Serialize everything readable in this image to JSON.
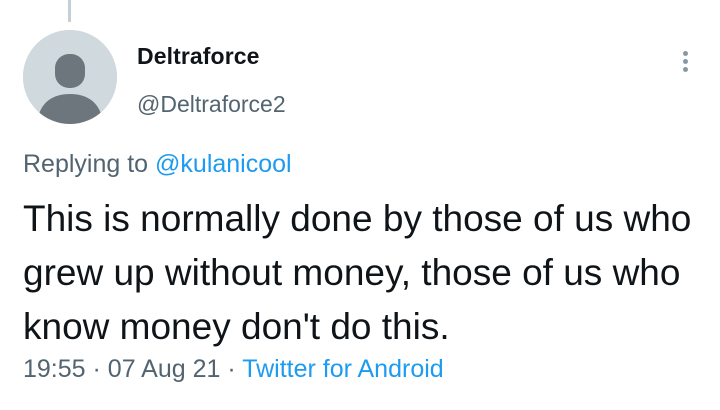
{
  "tweet": {
    "author": {
      "display_name": "Deltraforce",
      "handle": "@Deltraforce2",
      "avatar_icon": "default-avatar-icon"
    },
    "replying_to": {
      "prefix": "Replying to",
      "mention": "@kulanicool"
    },
    "text": "This is normally done by those of us who grew up without money, those of us who know money don't do this.",
    "time": "19:55",
    "date": "07 Aug 21",
    "separator": "·",
    "source": "Twitter for Android"
  },
  "more_icon": "more-vertical-icon",
  "colors": {
    "link": "#1d9bf0",
    "secondary_text": "#536471",
    "primary_text": "#0f1419",
    "avatar_bg": "#cfd9de",
    "avatar_fg": "#6e767d"
  }
}
